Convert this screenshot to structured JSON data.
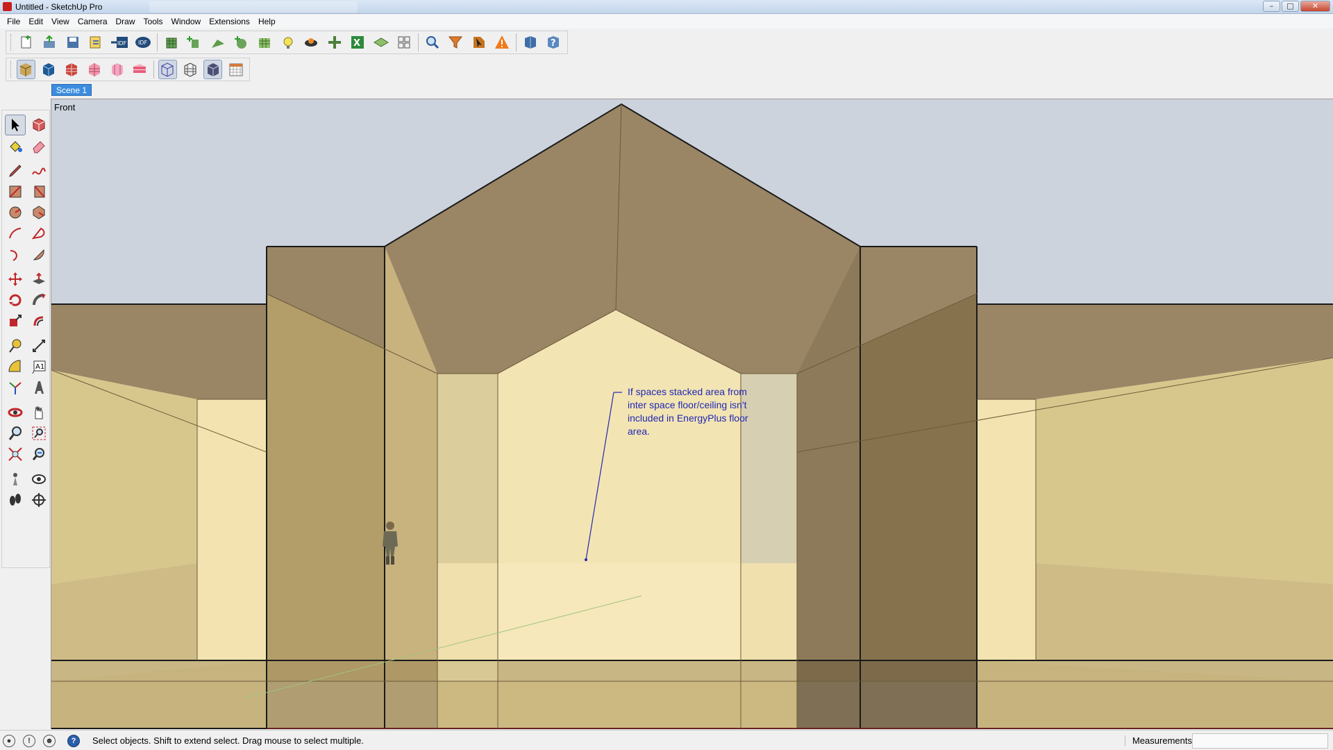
{
  "window": {
    "title": "Untitled - SketchUp Pro",
    "minimize": "–",
    "maximize": "□",
    "close": "✕"
  },
  "menu": [
    "File",
    "Edit",
    "View",
    "Camera",
    "Draw",
    "Tools",
    "Window",
    "Extensions",
    "Help"
  ],
  "toolbar_main": [
    "new-space-icon",
    "open-file-icon",
    "save-icon",
    "save-as-icon",
    "import-idf-icon",
    "export-idf-icon",
    "new-building-icon",
    "new-shading-icon",
    "new-site-shading-icon",
    "new-interior-partition-icon",
    "new-daylighting-icon",
    "new-illuminance-map-icon",
    "new-glare-sensor-icon",
    "set-attributes-icon",
    "surface-matching-icon",
    "project-loose-geometry-icon",
    "surface-search-icon",
    "filter-icon",
    "info-tool-icon",
    "warning-icon",
    "open-studio-icon",
    "help-icon"
  ],
  "toolbar_render": [
    "render-by-class-icon",
    "render-by-boundary-icon",
    "render-by-construction-icon",
    "render-by-thermal-zone-icon",
    "render-by-space-type-icon",
    "render-by-story-icon",
    "xray-icon",
    "hidden-line-icon",
    "shaded-icon",
    "calendar-icon"
  ],
  "scene_tab": "Scene 1",
  "palette_tools": [
    "select-arrow-icon",
    "make-component-icon",
    "paint-bucket-icon",
    "eraser-icon",
    "pencil-line-icon",
    "freehand-icon",
    "rectangle-icon",
    "rotated-rectangle-icon",
    "circle-icon",
    "polygon-icon",
    "arc-icon",
    "two-point-arc-icon",
    "three-point-arc-icon",
    "pie-icon",
    "move-icon",
    "push-pull-icon",
    "rotate-icon",
    "follow-me-icon",
    "scale-icon",
    "offset-icon",
    "tape-measure-icon",
    "dimension-icon",
    "protractor-icon",
    "text-icon",
    "axes-icon",
    "3d-text-icon",
    "orbit-icon",
    "pan-icon",
    "zoom-icon",
    "zoom-window-icon",
    "zoom-extents-icon",
    "previous-view-icon",
    "position-camera-icon",
    "look-around-icon",
    "walk-icon",
    "section-plane-icon"
  ],
  "viewport": {
    "view_name": "Front",
    "annotation": "If spaces stacked area from\ninter space floor/ceiling isn't\nincluded in EnergyPlus floor\narea."
  },
  "status": {
    "message": "Select objects. Shift to extend select. Drag mouse to select multiple.",
    "measurements_label": "Measurements",
    "measurements_value": ""
  },
  "colors": {
    "sky": "#ccd3dc",
    "ground": "#d4d4d2",
    "wall_light": "#f0e2b4",
    "wall_mid": "#c9b888",
    "roof_dark": "#9a8565",
    "annotation": "#1e28b4",
    "scene_tab": "#3c8de0"
  }
}
